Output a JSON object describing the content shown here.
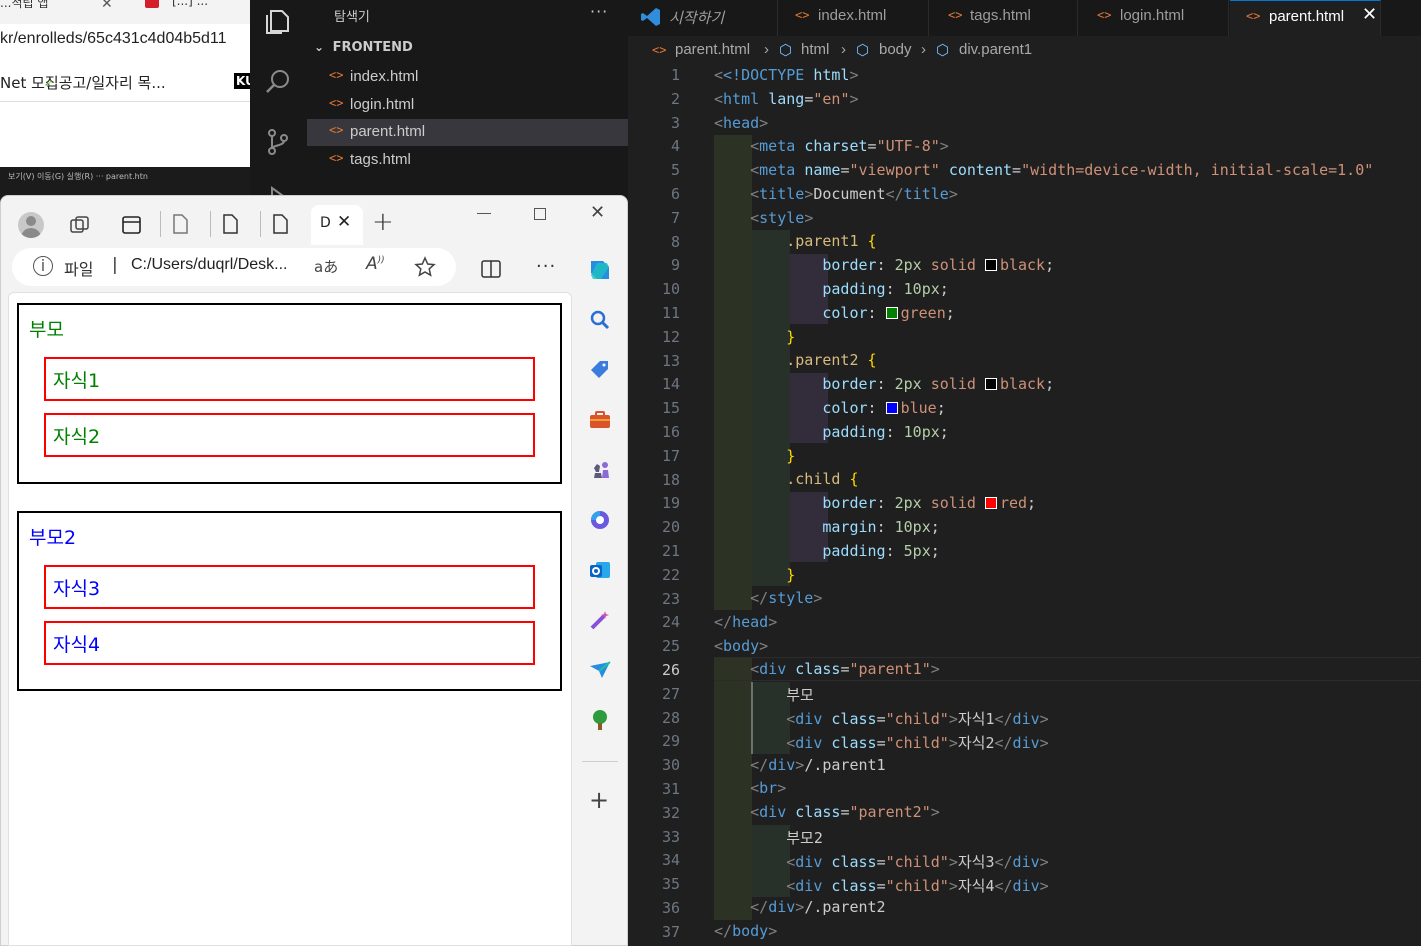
{
  "bg_browser": {
    "tab1": "...적립 앱",
    "tab2": "[...] ...",
    "url": "kr/enrolleds/65c431c4d04b5d11",
    "bookmarks": "Net     모집공고/일자리 목...",
    "bookmark_badge": "KU",
    "dark_strip": "보기(V)   이동(G)   실행(R)    ···                                   parent.htn"
  },
  "vscode": {
    "explorer_title": "탐색기",
    "explorer_more": "···",
    "folder": "FRONTEND",
    "files": [
      "index.html",
      "login.html",
      "parent.html",
      "tags.html"
    ],
    "active_file": "parent.html",
    "tabs": [
      "시작하기",
      "index.html",
      "tags.html",
      "login.html",
      "parent.html"
    ],
    "breadcrumb": [
      "parent.html",
      "html",
      "body",
      "div.parent1"
    ],
    "current_line": 26,
    "line_numbers": [
      1,
      2,
      3,
      4,
      5,
      6,
      7,
      8,
      9,
      10,
      11,
      12,
      13,
      14,
      15,
      16,
      17,
      18,
      19,
      20,
      21,
      22,
      23,
      24,
      25,
      26,
      27,
      28,
      29,
      30,
      31,
      32,
      33,
      34,
      35,
      36,
      37
    ],
    "code": {
      "l1_doctype": "<!DOCTYPE",
      "l1_html": " html",
      "l1_close": ">",
      "l2_lang": "en",
      "l4_charset": "UTF-8",
      "l5_name": "viewport",
      "l5_content": "width=device-width, initial-scale=1.0",
      "l6_title": "Document",
      "sel1": ".parent1",
      "sel2": ".parent2",
      "sel3": ".child",
      "border": "border",
      "padding": "padding",
      "color": "color",
      "margin": "margin",
      "two_px": "2px",
      "solid": "solid",
      "ten_px": "10px",
      "five_px": "5px",
      "black": "black",
      "green": "green",
      "blue": "blue",
      "red": "red",
      "parent1": "parent1",
      "parent2": "parent2",
      "child": "child",
      "text_bumo": "부모",
      "text_bumo2": "부모2",
      "text_c1": "자식1",
      "text_c2": "자식2",
      "text_c3": "자식3",
      "text_c4": "자식4",
      "comment1": "/.parent1",
      "comment2": "/.parent2"
    }
  },
  "colors": {
    "swatch_black": "#000000",
    "swatch_green": "#008000",
    "swatch_blue": "#0000ff",
    "swatch_red": "#ff0000"
  },
  "edge": {
    "tab_label": "D",
    "new_tab": "+",
    "address_prefix": "파일",
    "address": "C:/Users/duqrl/Desk...",
    "read_aloud": "aあ",
    "sidebar_add": "+"
  },
  "page": {
    "parent1_text": "부모",
    "child1": "자식1",
    "child2": "자식2",
    "parent2_text": "부모2",
    "child3": "자식3",
    "child4": "자식4"
  }
}
